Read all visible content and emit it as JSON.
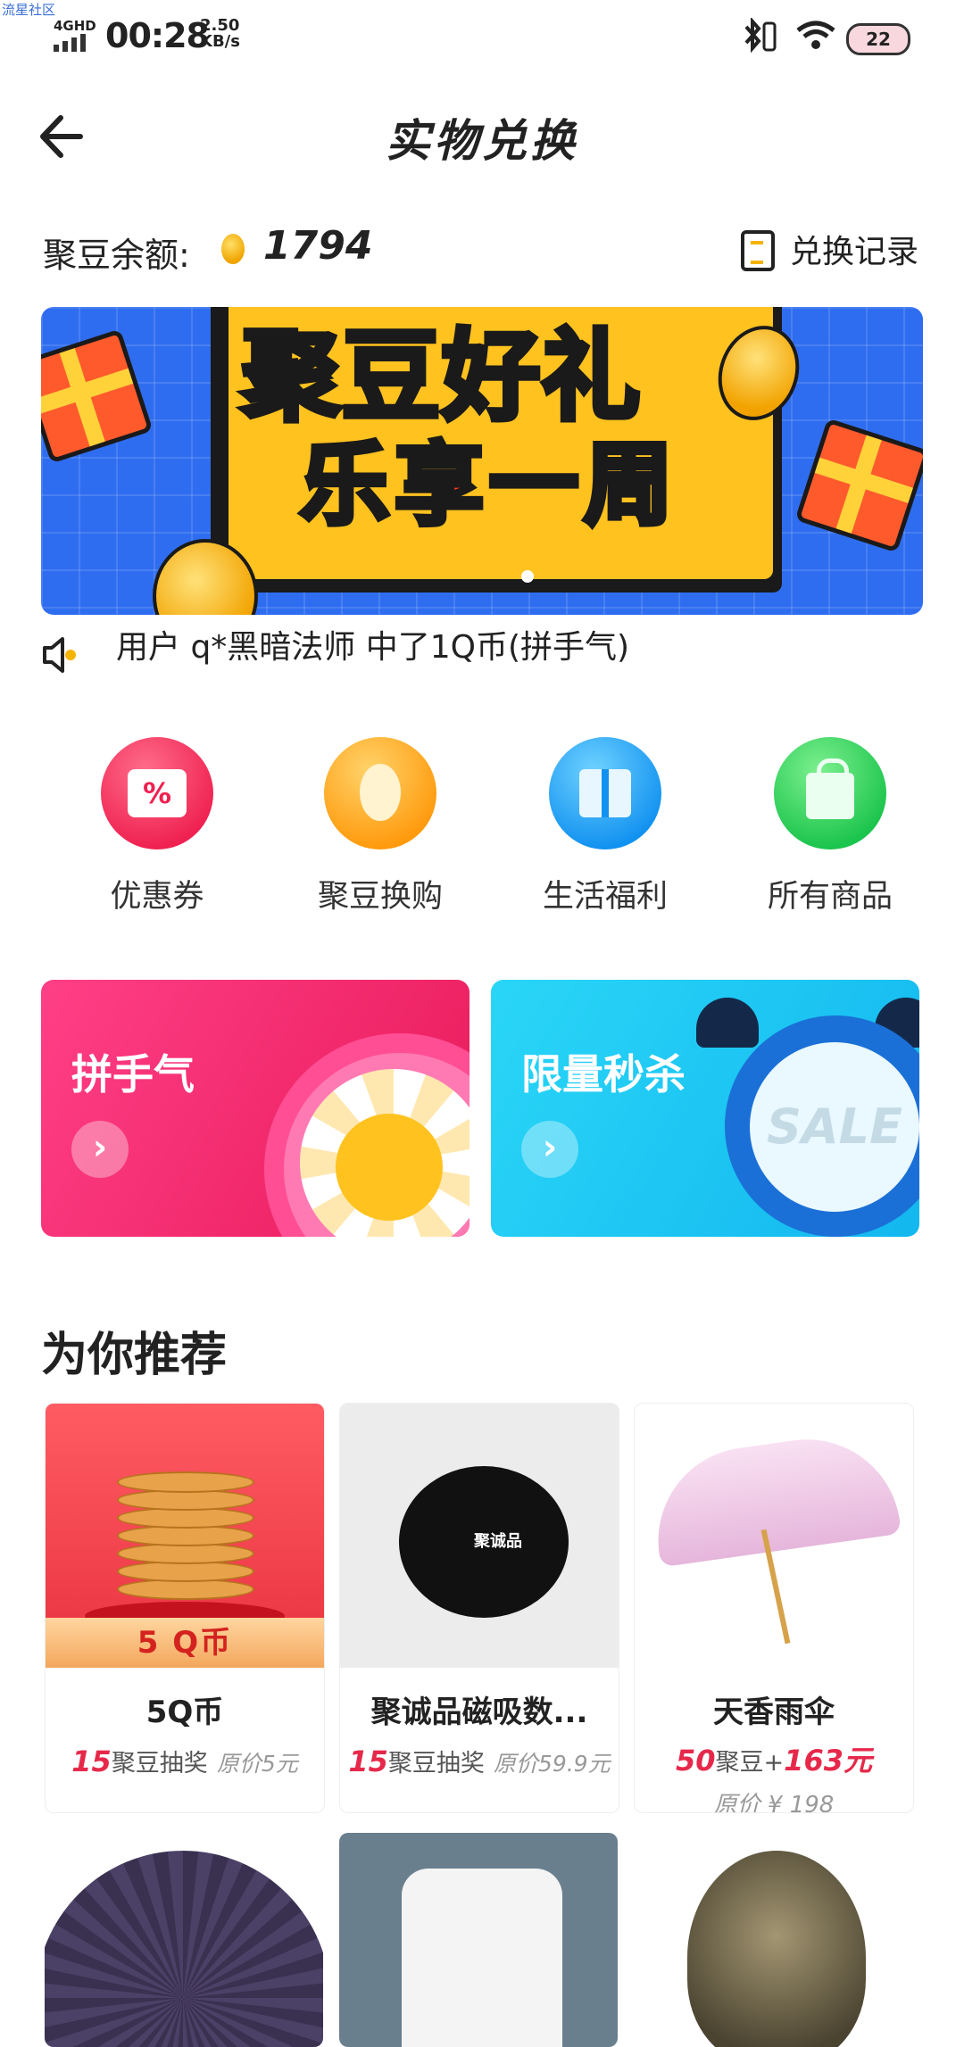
{
  "watermark": "流星社区",
  "status_bar": {
    "network_type": "4GHD",
    "time": "00:28",
    "speed_value": "2.50",
    "speed_unit": "KB/s",
    "battery": "22",
    "icons": [
      "signal-icon",
      "bluetooth-icon",
      "wifi-icon",
      "battery-icon"
    ]
  },
  "header": {
    "title": "实物兑换",
    "back_icon": "back-arrow-icon"
  },
  "balance": {
    "label": "聚豆余额:",
    "value": "1794",
    "record_label": "兑换记录"
  },
  "banner": {
    "line1": "聚豆好礼",
    "line2": "乐享一周"
  },
  "notice": {
    "text": "用户 q*黑暗法师 中了1Q币(拼手气)"
  },
  "categories": [
    {
      "label": "优惠券",
      "color": "#ef2150",
      "icon": "coupon-icon"
    },
    {
      "label": "聚豆换购",
      "color": "#ff9a0d",
      "icon": "bean-icon"
    },
    {
      "label": "生活福利",
      "color": "#1292f0",
      "icon": "gift-icon"
    },
    {
      "label": "所有商品",
      "color": "#1bc44c",
      "icon": "bag-icon"
    }
  ],
  "promos": [
    {
      "title": "拼手气",
      "arrow": "›"
    },
    {
      "title": "限量秒杀",
      "arrow": "›",
      "watermark": "SALE"
    }
  ],
  "section": {
    "title": "为你推荐"
  },
  "products": [
    {
      "name": "5Q币",
      "badge": "5 Q币",
      "price_num": "15",
      "price_text": "聚豆抽奖",
      "orig": "原价5元"
    },
    {
      "name": "聚诚品磁吸数...",
      "brand": "聚诚品",
      "price_num": "15",
      "price_text": "聚豆抽奖",
      "orig": "原价59.9元"
    },
    {
      "name": "天香雨伞",
      "price_num1": "50",
      "price_mid": "聚豆+",
      "price_num2": "163元",
      "orig": "原价 ¥ 198"
    }
  ]
}
